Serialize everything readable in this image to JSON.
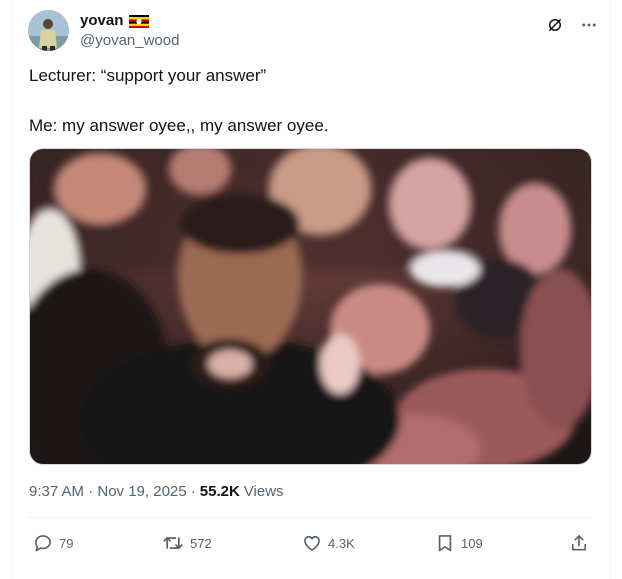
{
  "tweet": {
    "display_name": "yovan",
    "flag_icon": "uganda-flag-icon",
    "handle": "@yovan_wood",
    "text_line1": "Lecturer: “support your answer”",
    "text_line2": "Me: my answer oyee,, my answer oyee.",
    "media_description_icon": "crowd-photo",
    "timestamp": "9:37 AM · Nov 19, 2025 ·",
    "views_count": "55.2K",
    "views_label": "Views"
  },
  "actions": {
    "replies": "79",
    "reposts": "572",
    "likes": "4.3K",
    "bookmarks": "109"
  },
  "colors": {
    "text_primary": "#0f1419",
    "text_secondary": "#536471",
    "divider": "#eff3f4"
  }
}
